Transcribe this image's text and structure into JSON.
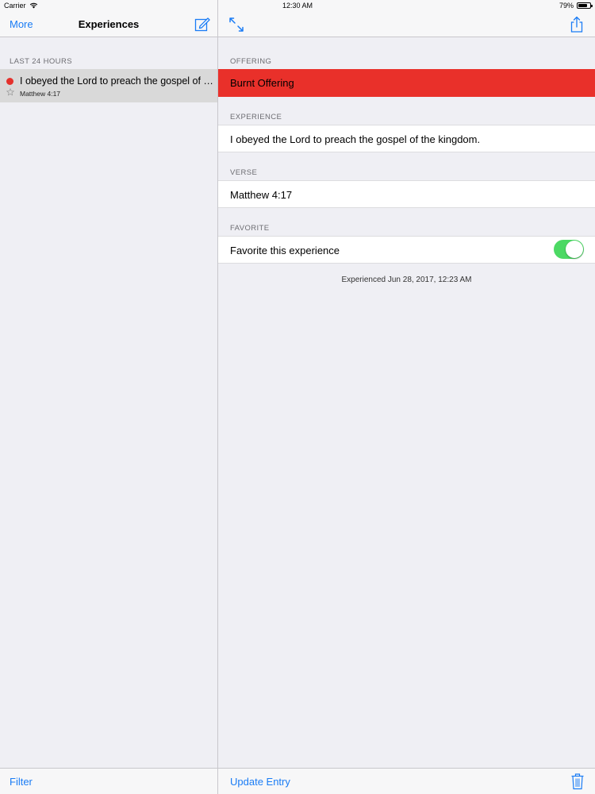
{
  "status": {
    "carrier": "Carrier",
    "time": "12:30 AM",
    "battery": "79%",
    "battery_level": 0.79
  },
  "master": {
    "nav": {
      "left": "More",
      "title": "Experiences",
      "right_icon": "compose-icon"
    },
    "section": "LAST 24 HOURS",
    "rows": [
      {
        "title": "I obeyed the Lord to preach the gospel of the kingdom.",
        "subtitle": "Matthew 4:17",
        "dot_color": "#e4312c",
        "favorite_icon": "star-outline-icon"
      }
    ],
    "toolbar": {
      "filter": "Filter"
    }
  },
  "detail": {
    "nav": {
      "left_icon": "expand-icon",
      "right_icon": "share-icon"
    },
    "offering": {
      "header": "OFFERING",
      "value": "Burnt Offering",
      "color": "#e9302a"
    },
    "experience": {
      "header": "EXPERIENCE",
      "value": "I obeyed the Lord to preach the gospel of the kingdom."
    },
    "verse": {
      "header": "VERSE",
      "value": "Matthew 4:17"
    },
    "favorite": {
      "header": "FAVORITE",
      "label": "Favorite this experience",
      "on": true,
      "color": "#4cd964"
    },
    "timestamp": "Experienced Jun 28, 2017, 12:23 AM",
    "toolbar": {
      "update": "Update Entry",
      "delete_icon": "trash-icon"
    }
  },
  "colors": {
    "tint": "#1a7cf5",
    "background": "#efeff4",
    "selected_row": "#d9d9d9"
  }
}
